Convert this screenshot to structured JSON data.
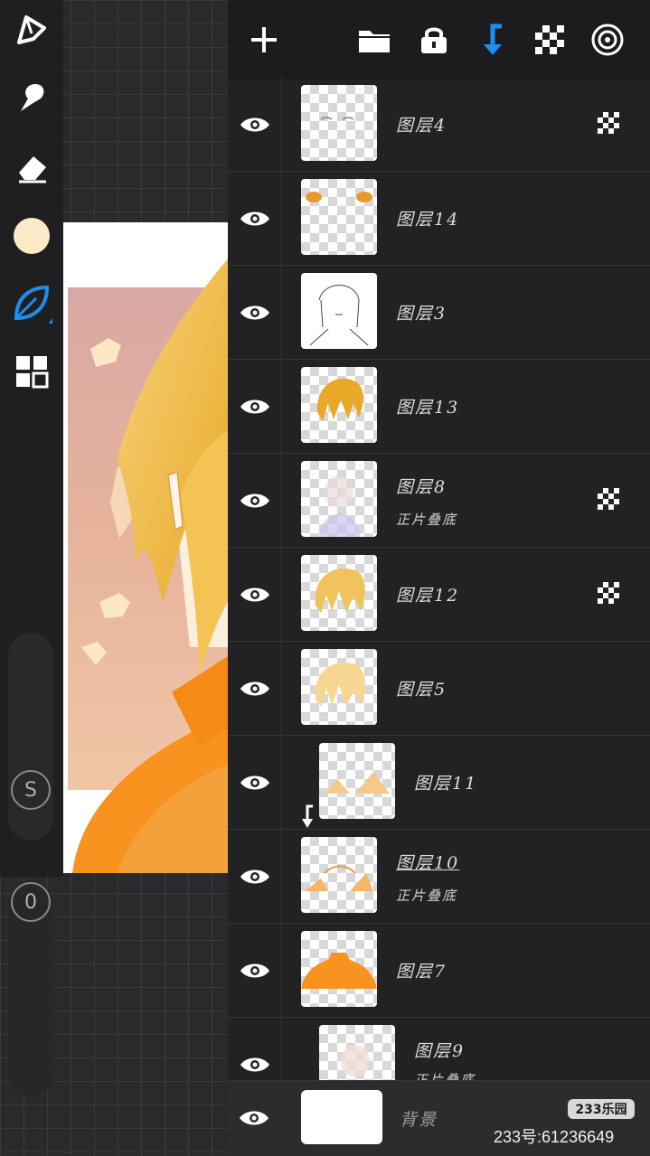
{
  "toolbar": {
    "tools": [
      "brush-icon",
      "smudge-icon",
      "eraser-icon",
      "color-swatch",
      "leaf-icon",
      "layers-grid-icon"
    ],
    "current_color": "#fdebc8",
    "accent": "#1e8ef0",
    "size_button_label": "S",
    "opacity_button_label": "0"
  },
  "layers_panel": {
    "header_icons": [
      "add-icon",
      "folder-icon",
      "lock-icon",
      "merge-down-icon",
      "checker-icon",
      "target-icon"
    ],
    "layers": [
      {
        "name": "图层4",
        "mode": "",
        "alpha_lock": true,
        "clipped": false
      },
      {
        "name": "图层14",
        "mode": "",
        "alpha_lock": false,
        "clipped": false
      },
      {
        "name": "图层3",
        "mode": "",
        "alpha_lock": false,
        "clipped": false
      },
      {
        "name": "图层13",
        "mode": "",
        "alpha_lock": false,
        "clipped": false
      },
      {
        "name": "图层8",
        "mode": "正片叠底",
        "alpha_lock": true,
        "clipped": false
      },
      {
        "name": "图层12",
        "mode": "",
        "alpha_lock": true,
        "clipped": false
      },
      {
        "name": "图层5",
        "mode": "",
        "alpha_lock": false,
        "clipped": false
      },
      {
        "name": "图层11",
        "mode": "",
        "alpha_lock": false,
        "clipped": true
      },
      {
        "name": "图层10",
        "mode": "正片叠底",
        "alpha_lock": false,
        "clipped": false
      },
      {
        "name": "图层7",
        "mode": "",
        "alpha_lock": false,
        "clipped": false
      },
      {
        "name": "图层9",
        "mode": "正片叠底",
        "alpha_lock": false,
        "clipped": true
      }
    ],
    "background_layer": {
      "name": "背景"
    }
  },
  "watermark": {
    "logo": "233乐园",
    "id_text": "233号:61236649"
  }
}
